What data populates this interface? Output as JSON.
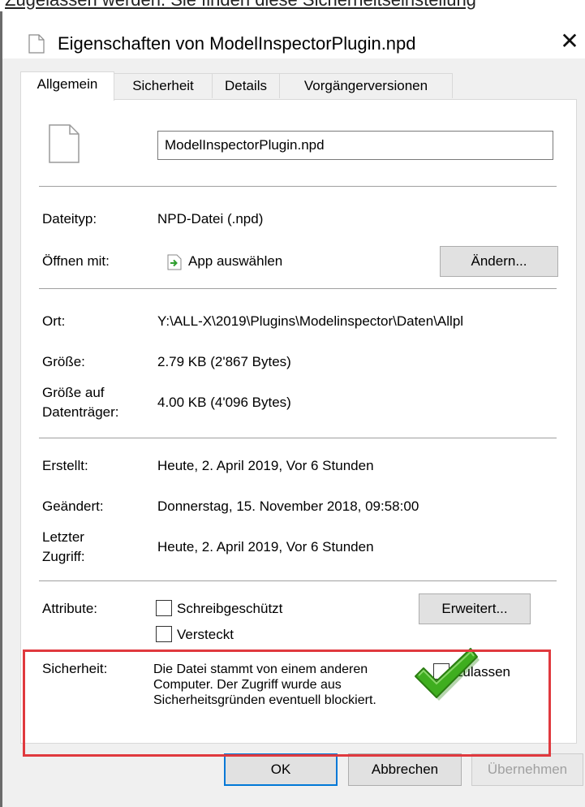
{
  "background_caption": "Zugelassen werden. Sie finden diese Sicherheitseinstellung",
  "window": {
    "title": "Eigenschaften von ModelInspectorPlugin.npd",
    "close_symbol": "✕"
  },
  "tabs": [
    {
      "label": "Allgemein",
      "active": true
    },
    {
      "label": "Sicherheit",
      "active": false
    },
    {
      "label": "Details",
      "active": false
    },
    {
      "label": "Vorgängerversionen",
      "active": false
    }
  ],
  "general": {
    "filename": "ModelInspectorPlugin.npd",
    "file_type_label": "Dateityp:",
    "file_type_value": "NPD-Datei (.npd)",
    "open_with_label": "Öffnen mit:",
    "open_with_value": "App auswählen",
    "change_button": "Ändern...",
    "location_label": "Ort:",
    "location_value": "Y:\\ALL-X\\2019\\Plugins\\Modelinspector\\Daten\\Allpl",
    "size_label": "Größe:",
    "size_value": "2.79 KB (2'867 Bytes)",
    "size_on_disk_label_1": "Größe auf",
    "size_on_disk_label_2": "Datenträger:",
    "size_on_disk_value": "4.00 KB (4'096 Bytes)",
    "created_label": "Erstellt:",
    "created_value": "Heute, 2. April 2019, Vor 6 Stunden",
    "modified_label": "Geändert:",
    "modified_value": "Donnerstag, 15. November 2018, 09:58:00",
    "accessed_label_1": "Letzter",
    "accessed_label_2": "Zugriff:",
    "accessed_value": "Heute, 2. April 2019, Vor 6 Stunden",
    "attributes_label": "Attribute:",
    "readonly_label": "Schreibgeschützt",
    "readonly_checked": false,
    "hidden_label": "Versteckt",
    "hidden_checked": false,
    "advanced_button": "Erweitert...",
    "security_label": "Sicherheit:",
    "security_text": "Die Datei stammt von einem anderen Computer. Der Zugriff wurde aus Sicherheitsgründen eventuell blockiert.",
    "unblock_label": "Zulassen",
    "unblock_checked": true
  },
  "footer": {
    "ok_button": "OK",
    "cancel_button": "Abbrechen",
    "apply_button": "Übernehmen"
  },
  "colors": {
    "highlight_frame": "#e0393e",
    "check_mark": "#3fae1f",
    "default_button_border": "#0078d7"
  }
}
